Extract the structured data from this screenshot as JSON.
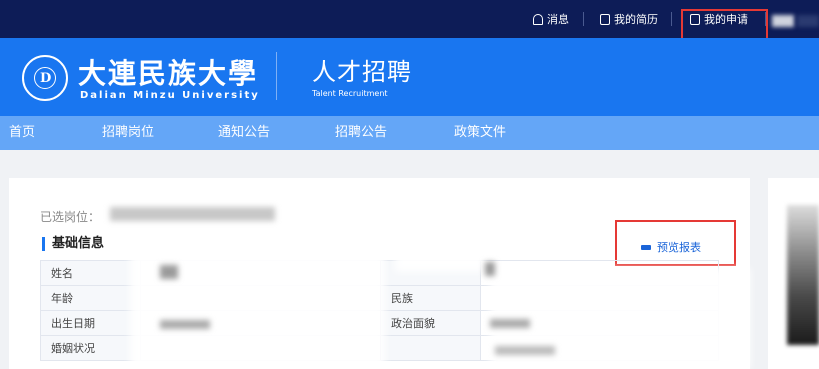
{
  "topbar": {
    "items": [
      {
        "label": "消息",
        "icon": "bell-icon"
      },
      {
        "label": "我的简历",
        "icon": "resume-icon"
      },
      {
        "label": "我的申请",
        "icon": "application-icon"
      }
    ]
  },
  "banner": {
    "university_cn": "大連民族大學",
    "university_en": "Dalian Minzu University",
    "title": "人才招聘",
    "subtitle": "Talent Recruitment"
  },
  "nav": {
    "items": [
      "首页",
      "招聘岗位",
      "通知公告",
      "招聘公告",
      "政策文件"
    ]
  },
  "content": {
    "selected_label": "已选岗位：",
    "section_title": "基础信息",
    "preview_label": "预览报表",
    "rows": [
      {
        "label": "姓名",
        "label2": ""
      },
      {
        "label": "年龄",
        "label2": "民族"
      },
      {
        "label": "出生日期",
        "label2": "政治面貌"
      },
      {
        "label": "婚姻状况",
        "label2": ""
      }
    ]
  },
  "colors": {
    "topbar": "#0d1c57",
    "banner": "#1976f0",
    "nav": "#64a6f7",
    "highlight": "#e53935",
    "link": "#1a64d8"
  }
}
